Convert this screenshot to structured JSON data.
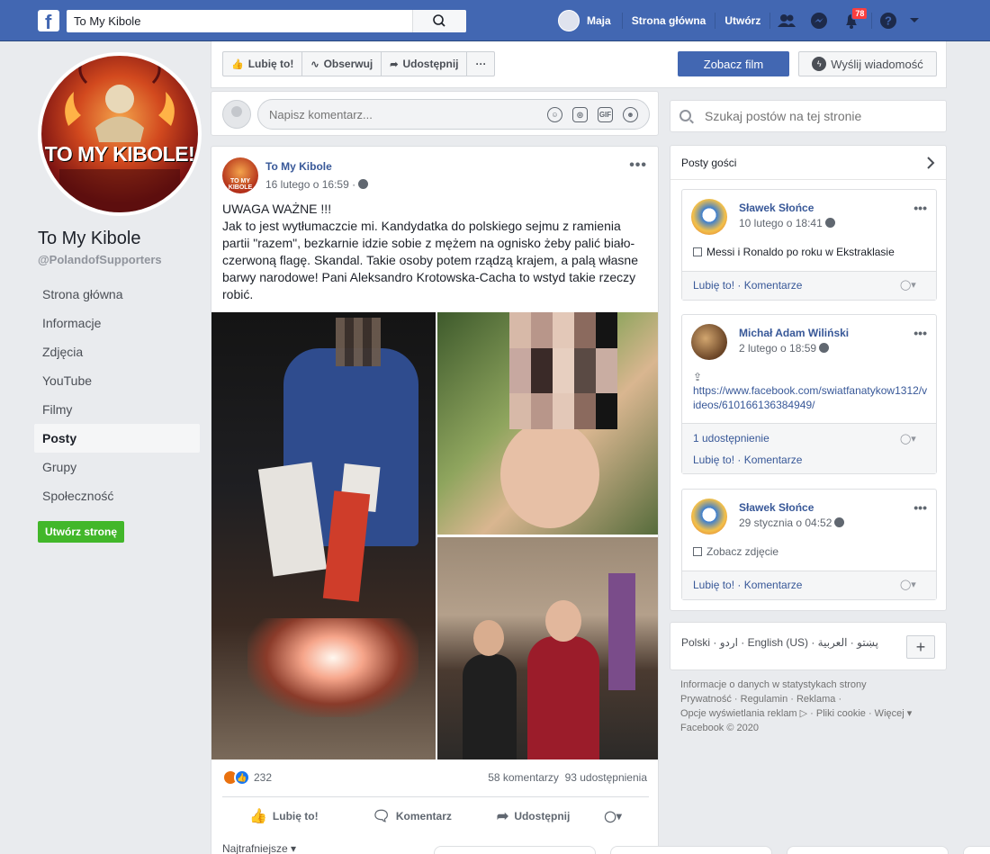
{
  "topbar": {
    "logo": "f",
    "search_value": "To My Kibole",
    "user_name": "Maja",
    "home_label": "Strona główna",
    "create_label": "Utwórz",
    "notifications_count": "78",
    "icons": [
      "friends-icon",
      "messenger-icon",
      "bell-icon",
      "help-icon",
      "chevron-down-icon"
    ]
  },
  "page": {
    "name": "To My Kibole",
    "handle": "@PolandofSupporters",
    "profile_text": "TO MY KIBOLE!",
    "nav": [
      "Strona główna",
      "Informacje",
      "Zdjęcia",
      "YouTube",
      "Filmy",
      "Posty",
      "Grupy",
      "Społeczność"
    ],
    "active_nav": "Posty",
    "create_page_label": "Utwórz stronę"
  },
  "actions": {
    "like": "Lubię to!",
    "follow": "Obserwuj",
    "share": "Udostępnij",
    "more": "···",
    "watch": "Zobacz film",
    "message": "Wyślij wiadomość"
  },
  "composer": {
    "placeholder": "Napisz komentarz...",
    "tools": [
      "emoji-icon",
      "camera-icon",
      "gif-icon",
      "sticker-icon"
    ]
  },
  "post": {
    "author": "To My Kibole",
    "avatar_text": "TO MY KIBOLE",
    "time": "16 lutego o 16:59 ·",
    "more": "•••",
    "text": "UWAGA WAŻNE !!!\nJak to jest wytłumaczcie mi. Kandydatka do polskiego sejmu z ramienia partii \"razem\", bezkarnie idzie sobie z mężem na ognisko żeby palić biało-czerwoną flagę. Skandal. Takie osoby potem rządzą krajem, a palą własne barwy narodowe! Pani Aleksandro Krotowska-Cacha to wstyd takie rzeczy robić.",
    "reactions_count": "232",
    "comments": "58 komentarzy",
    "shares": "93 udostępnienia",
    "action_like": "Lubię to!",
    "action_comment": "Komentarz",
    "action_share": "Udostępnij",
    "sort": "Najtrafniejsze ▾"
  },
  "right": {
    "search_placeholder": "Szukaj postów na tej stronie",
    "visitors_title": "Posty gości",
    "visitor_posts": [
      {
        "name": "Sławek Słońce",
        "time": "10 lutego o 18:41",
        "body": "Messi i Ronaldo po roku w Ekstraklasie",
        "foot_links": "Lubię to! · Komentarze"
      },
      {
        "name": "Michał Adam Wiliński",
        "time": "2 lutego o 18:59",
        "body": "https://www.facebook.com/swiatfanatykow1312/videos/610166136384949/",
        "foot_shares": "1 udostępnienie",
        "foot_links": "Lubię to! · Komentarze"
      },
      {
        "name": "Sławek Słońce",
        "time": "29 stycznia o 04:52",
        "body": "Zobacz zdjęcie",
        "foot_links": "Lubię to! · Komentarze"
      }
    ],
    "languages": "Polski · اردو · English (US) · پښتو · العربية",
    "footer": "Informacje o danych w statystykach strony\nPrywatność · Regulamin · Reklama ·\nOpcje wyświetlania reklam ▷ · Pliki cookie · Więcej ▾\nFacebook © 2020"
  }
}
